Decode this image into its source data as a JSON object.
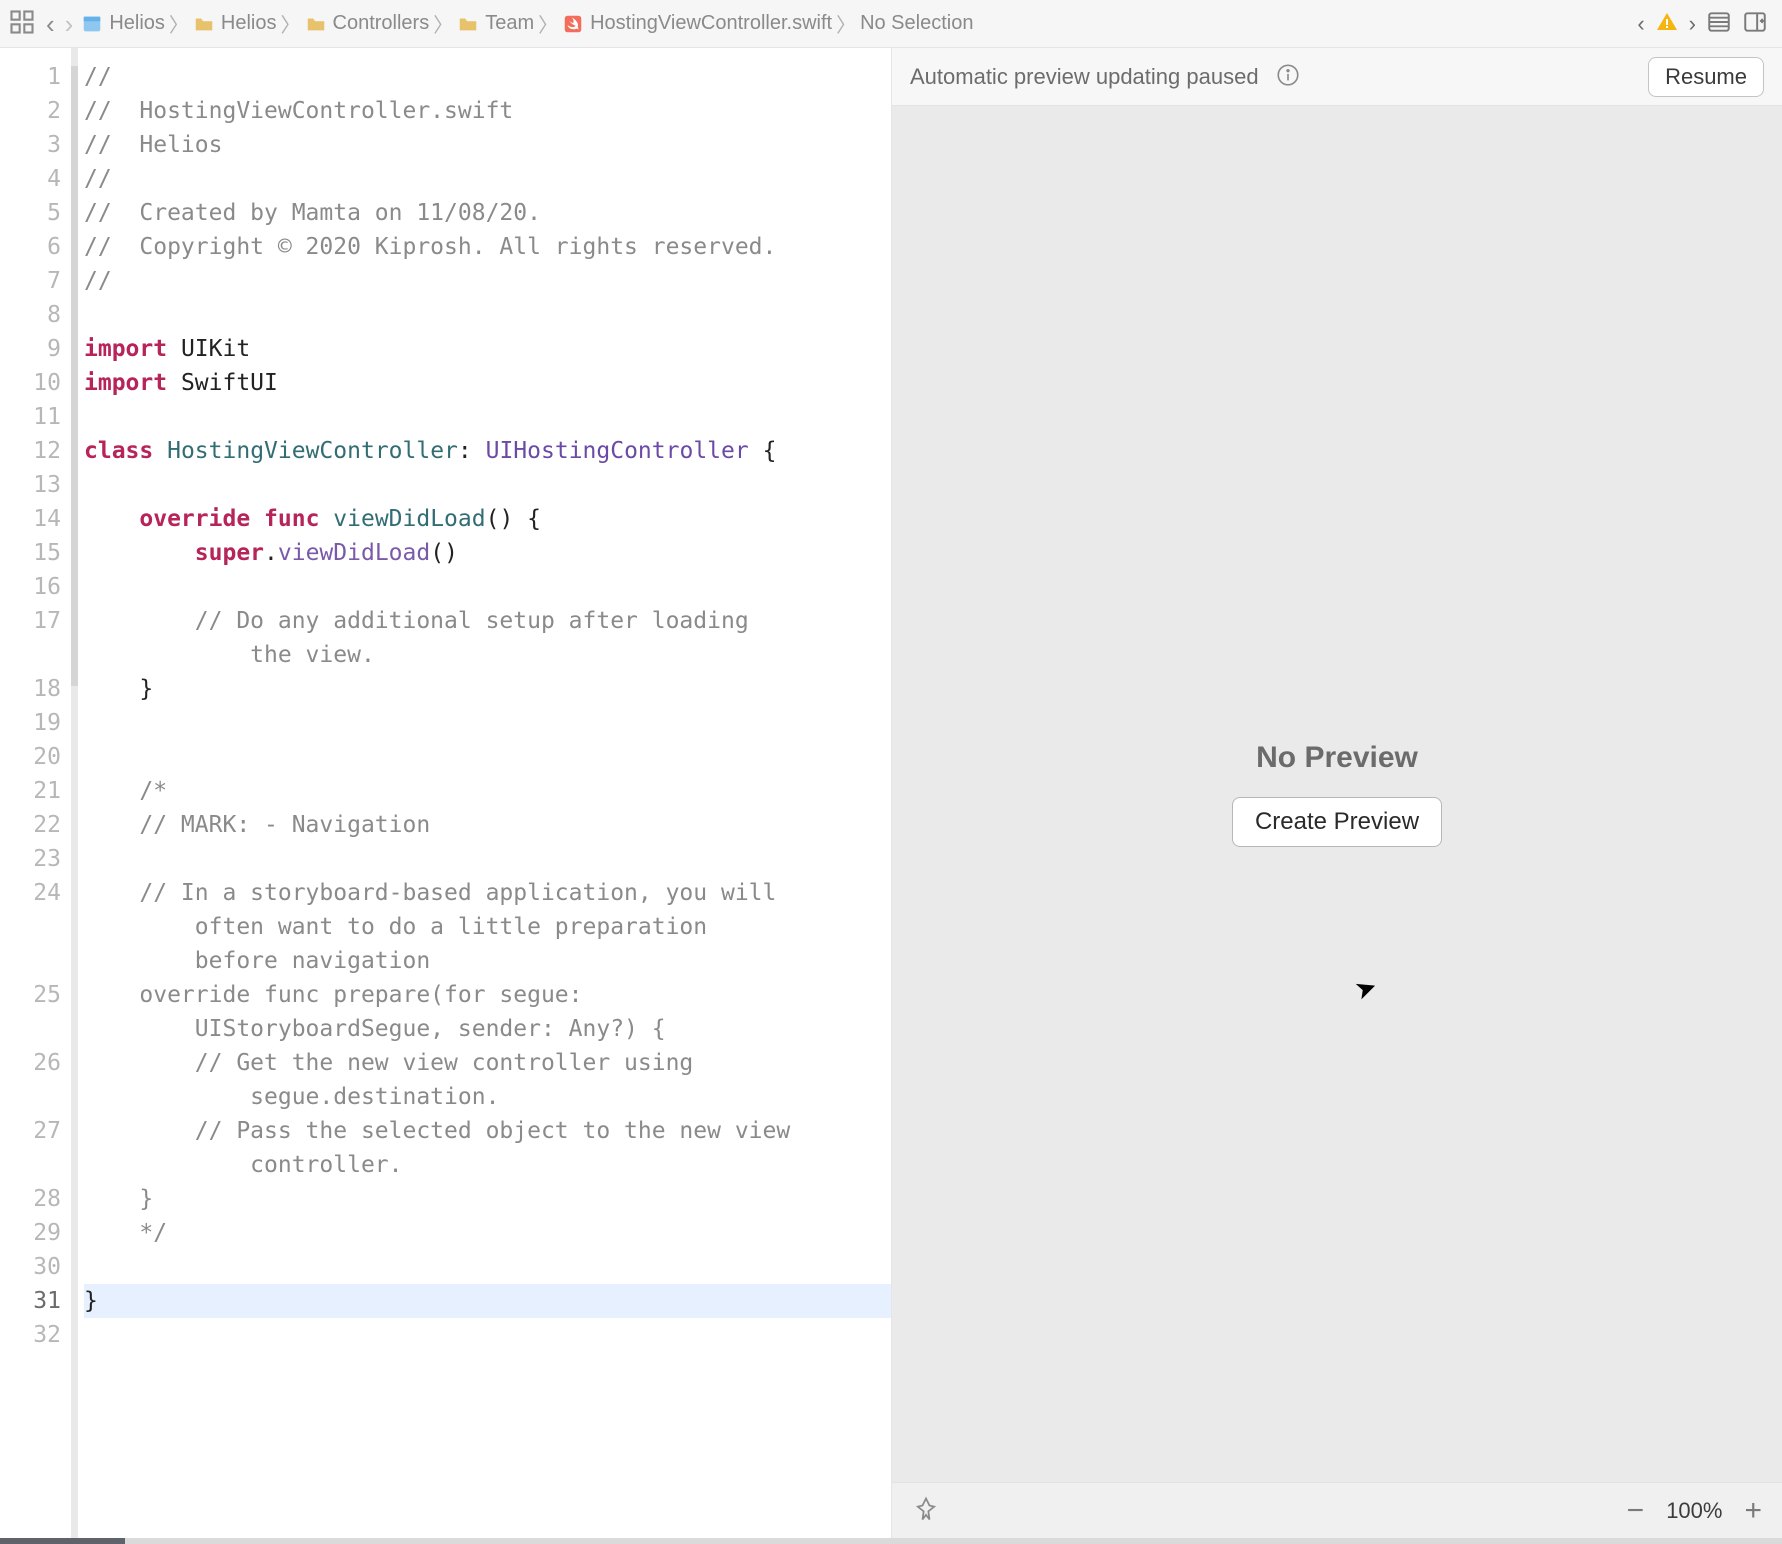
{
  "breadcrumbs": {
    "items": [
      {
        "label": "Helios",
        "icon": "project"
      },
      {
        "label": "Helios",
        "icon": "folder"
      },
      {
        "label": "Controllers",
        "icon": "folder"
      },
      {
        "label": "Team",
        "icon": "folder"
      },
      {
        "label": "HostingViewController.swift",
        "icon": "swift"
      },
      {
        "label": "No Selection",
        "icon": ""
      }
    ]
  },
  "editor": {
    "current_line": 31,
    "lines": [
      {
        "n": 1,
        "tokens": [
          {
            "c": "comment",
            "t": "//"
          }
        ]
      },
      {
        "n": 2,
        "tokens": [
          {
            "c": "comment",
            "t": "//  HostingViewController.swift"
          }
        ]
      },
      {
        "n": 3,
        "tokens": [
          {
            "c": "comment",
            "t": "//  Helios"
          }
        ]
      },
      {
        "n": 4,
        "tokens": [
          {
            "c": "comment",
            "t": "//"
          }
        ]
      },
      {
        "n": 5,
        "tokens": [
          {
            "c": "comment",
            "t": "//  Created by Mamta on 11/08/20."
          }
        ]
      },
      {
        "n": 6,
        "tokens": [
          {
            "c": "comment",
            "t": "//  Copyright © 2020 Kiprosh. All rights reserved."
          }
        ]
      },
      {
        "n": 7,
        "tokens": [
          {
            "c": "comment",
            "t": "//"
          }
        ]
      },
      {
        "n": 8,
        "tokens": [
          {
            "c": "plain",
            "t": ""
          }
        ]
      },
      {
        "n": 9,
        "tokens": [
          {
            "c": "keyword",
            "t": "import"
          },
          {
            "c": "plain",
            "t": " UIKit"
          }
        ]
      },
      {
        "n": 10,
        "tokens": [
          {
            "c": "keyword",
            "t": "import"
          },
          {
            "c": "plain",
            "t": " SwiftUI"
          }
        ]
      },
      {
        "n": 11,
        "tokens": [
          {
            "c": "plain",
            "t": ""
          }
        ]
      },
      {
        "n": 12,
        "tokens": [
          {
            "c": "keyword",
            "t": "class"
          },
          {
            "c": "plain",
            "t": " "
          },
          {
            "c": "type",
            "t": "HostingViewController"
          },
          {
            "c": "plain",
            "t": ": "
          },
          {
            "c": "funcname",
            "t": "UIHostingController"
          },
          {
            "c": "plain",
            "t": " {"
          }
        ]
      },
      {
        "n": 13,
        "tokens": [
          {
            "c": "plain",
            "t": ""
          }
        ]
      },
      {
        "n": 14,
        "tokens": [
          {
            "c": "plain",
            "t": "    "
          },
          {
            "c": "keyword",
            "t": "override"
          },
          {
            "c": "plain",
            "t": " "
          },
          {
            "c": "keyword",
            "t": "func"
          },
          {
            "c": "plain",
            "t": " "
          },
          {
            "c": "type",
            "t": "viewDidLoad"
          },
          {
            "c": "plain",
            "t": "() {"
          }
        ]
      },
      {
        "n": 15,
        "tokens": [
          {
            "c": "plain",
            "t": "        "
          },
          {
            "c": "keyword",
            "t": "super"
          },
          {
            "c": "plain",
            "t": "."
          },
          {
            "c": "call",
            "t": "viewDidLoad"
          },
          {
            "c": "plain",
            "t": "()"
          }
        ]
      },
      {
        "n": 16,
        "tokens": [
          {
            "c": "plain",
            "t": ""
          }
        ]
      },
      {
        "n": 17,
        "wrap": true,
        "tokens": [
          {
            "c": "plain",
            "t": "        "
          },
          {
            "c": "comment",
            "t": "// Do any additional setup after loading\n            the view."
          }
        ]
      },
      {
        "n": 18,
        "tokens": [
          {
            "c": "plain",
            "t": "    }"
          }
        ]
      },
      {
        "n": 19,
        "tokens": [
          {
            "c": "plain",
            "t": ""
          }
        ]
      },
      {
        "n": 20,
        "tokens": [
          {
            "c": "plain",
            "t": ""
          }
        ]
      },
      {
        "n": 21,
        "tokens": [
          {
            "c": "plain",
            "t": "    "
          },
          {
            "c": "comment",
            "t": "/*"
          }
        ]
      },
      {
        "n": 22,
        "tokens": [
          {
            "c": "plain",
            "t": "    "
          },
          {
            "c": "comment",
            "t": "// MARK: - Navigation"
          }
        ]
      },
      {
        "n": 23,
        "tokens": [
          {
            "c": "plain",
            "t": ""
          }
        ]
      },
      {
        "n": 24,
        "wrap": true,
        "tokens": [
          {
            "c": "plain",
            "t": "    "
          },
          {
            "c": "comment",
            "t": "// In a storyboard-based application, you will\n        often want to do a little preparation\n        before navigation"
          }
        ],
        "h": 3
      },
      {
        "n": 25,
        "wrap": true,
        "tokens": [
          {
            "c": "plain",
            "t": "    "
          },
          {
            "c": "comment",
            "t": "override func prepare(for segue:\n        UIStoryboardSegue, sender: Any?) {"
          }
        ]
      },
      {
        "n": 26,
        "wrap": true,
        "tokens": [
          {
            "c": "plain",
            "t": "        "
          },
          {
            "c": "comment",
            "t": "// Get the new view controller using\n            segue.destination."
          }
        ]
      },
      {
        "n": 27,
        "wrap": true,
        "tokens": [
          {
            "c": "plain",
            "t": "        "
          },
          {
            "c": "comment",
            "t": "// Pass the selected object to the new view\n            controller."
          }
        ]
      },
      {
        "n": 28,
        "tokens": [
          {
            "c": "plain",
            "t": "    "
          },
          {
            "c": "comment",
            "t": "}"
          }
        ]
      },
      {
        "n": 29,
        "tokens": [
          {
            "c": "plain",
            "t": "    "
          },
          {
            "c": "comment",
            "t": "*/"
          }
        ]
      },
      {
        "n": 30,
        "tokens": [
          {
            "c": "plain",
            "t": ""
          }
        ]
      },
      {
        "n": 31,
        "tokens": [
          {
            "c": "plain",
            "t": "}"
          }
        ],
        "selected": true
      },
      {
        "n": 32,
        "tokens": [
          {
            "c": "plain",
            "t": ""
          }
        ]
      }
    ]
  },
  "preview": {
    "header_text": "Automatic preview updating paused",
    "resume_label": "Resume",
    "heading": "No Preview",
    "create_label": "Create Preview",
    "zoom_label": "100%"
  },
  "colors": {
    "keyword": "#b6245a",
    "type": "#326d74",
    "comment": "#8a8a8a"
  }
}
